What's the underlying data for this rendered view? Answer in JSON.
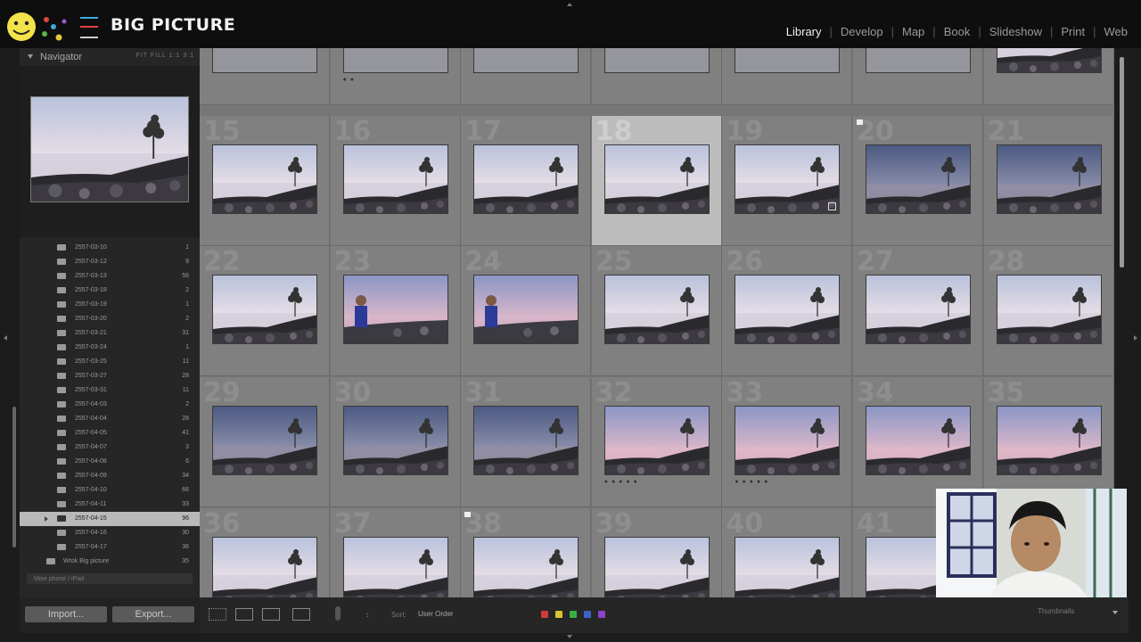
{
  "brand": {
    "title": "BIG PICTURE"
  },
  "modules": [
    {
      "label": "Library",
      "active": true
    },
    {
      "label": "Develop"
    },
    {
      "label": "Map"
    },
    {
      "label": "Book"
    },
    {
      "label": "Slideshow"
    },
    {
      "label": "Print"
    },
    {
      "label": "Web"
    }
  ],
  "navigator": {
    "title": "Navigator",
    "zooms": "FIT  FILL  1:1  3:1"
  },
  "folders": [
    {
      "name": "2557-03-10",
      "count": "1"
    },
    {
      "name": "2557-03-12",
      "count": "9"
    },
    {
      "name": "2557-03-13",
      "count": "56"
    },
    {
      "name": "2557-03-18",
      "count": "2"
    },
    {
      "name": "2557-03-19",
      "count": "1"
    },
    {
      "name": "2557-03-20",
      "count": "2"
    },
    {
      "name": "2557-03-21",
      "count": "31"
    },
    {
      "name": "2557-03-24",
      "count": "1"
    },
    {
      "name": "2557-03-25",
      "count": "11"
    },
    {
      "name": "2557-03-27",
      "count": "28"
    },
    {
      "name": "2557-03-31",
      "count": "11"
    },
    {
      "name": "2557-04-03",
      "count": "2"
    },
    {
      "name": "2557-04-04",
      "count": "28"
    },
    {
      "name": "2557-04-05",
      "count": "41"
    },
    {
      "name": "2557-04-07",
      "count": "3"
    },
    {
      "name": "2557-04-08",
      "count": "6"
    },
    {
      "name": "2557-04-09",
      "count": "34"
    },
    {
      "name": "2557-04-10",
      "count": "66"
    },
    {
      "name": "2557-04-11",
      "count": "33"
    },
    {
      "name": "2557-04-15",
      "count": "96",
      "selected": true
    },
    {
      "name": "2557-04-16",
      "count": "30"
    },
    {
      "name": "2557-04-17",
      "count": "36"
    },
    {
      "name": "Wrok Big picture",
      "count": "35",
      "root": true
    }
  ],
  "publish": {
    "label": "Mike phone / iPad"
  },
  "buttons": {
    "import": "Import...",
    "export": "Export..."
  },
  "grid": {
    "rows": [
      {
        "labels": [
          "",
          "",
          "",
          "",
          "",
          "",
          ""
        ]
      },
      {
        "labels": [
          "15",
          "16",
          "17",
          "18",
          "19",
          "20",
          "21"
        ]
      },
      {
        "labels": [
          "22",
          "23",
          "24",
          "25",
          "26",
          "27",
          "28"
        ]
      },
      {
        "labels": [
          "29",
          "30",
          "31",
          "32",
          "33",
          "34",
          "35"
        ]
      },
      {
        "labels": [
          "36",
          "37",
          "38",
          "39",
          "40",
          "41",
          ""
        ]
      }
    ],
    "selected_index": "18"
  },
  "toolbar": {
    "sort_label": "Sort:",
    "sort_value": "User Order",
    "thumbnails_label": "Thumbnails"
  },
  "colors": {
    "accent_red": "#d23b3b",
    "accent_yellow": "#d8c431",
    "accent_green": "#39b048",
    "accent_blue": "#3a63c9",
    "accent_purple": "#8a44c6"
  }
}
